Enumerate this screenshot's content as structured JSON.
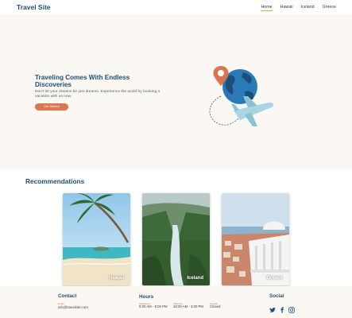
{
  "header": {
    "logo": "Travel Site",
    "nav": [
      {
        "label": "Home",
        "active": true
      },
      {
        "label": "Hawaii",
        "active": false
      },
      {
        "label": "Iceland",
        "active": false
      },
      {
        "label": "Greece",
        "active": false
      }
    ]
  },
  "hero": {
    "title": "Traveling Comes With Endless Discoveries",
    "text": "Don't let your dreams be just dreams. Experience the world by booking a vacation with us now.",
    "button": "Get Started"
  },
  "recommendations": {
    "title": "Recommendations",
    "cards": [
      {
        "label": "Hawaii"
      },
      {
        "label": "Iceland"
      },
      {
        "label": "Greece"
      }
    ]
  },
  "footer": {
    "contact": {
      "title": "Contact",
      "label": "Email",
      "value": "info@travelsite.com"
    },
    "hours": {
      "title": "Hours",
      "entries": [
        {
          "label": "Weekdays",
          "value": "9:00 AM - 5:00 PM"
        },
        {
          "label": "Saturday",
          "value": "10:00 AM - 4:00 PM"
        },
        {
          "label": "Sunday",
          "value": "Closed"
        }
      ]
    },
    "social": {
      "title": "Social",
      "icons": [
        "twitter-icon",
        "facebook-icon",
        "instagram-icon"
      ]
    }
  },
  "colors": {
    "brand_blue": "#1f4e79",
    "accent_orange": "#d9764f",
    "nav_underline": "#f2a541",
    "hero_bg": "#fbf8f3"
  }
}
